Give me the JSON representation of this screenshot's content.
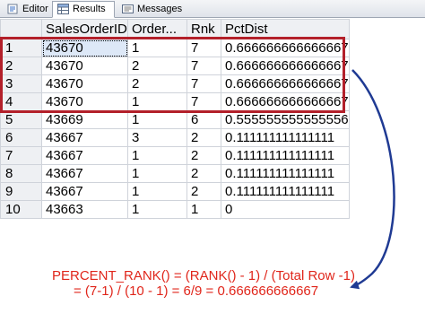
{
  "tabs": [
    {
      "label": "Editor",
      "icon": "editor-icon"
    },
    {
      "label": "Results",
      "icon": "results-grid-icon"
    },
    {
      "label": "Messages",
      "icon": "messages-icon"
    }
  ],
  "grid": {
    "columns": [
      "",
      "SalesOrderID",
      "Order...",
      "Rnk",
      "PctDist"
    ],
    "rows": [
      [
        "1",
        "43670",
        "1",
        "7",
        "0.666666666666667"
      ],
      [
        "2",
        "43670",
        "2",
        "7",
        "0.666666666666667"
      ],
      [
        "3",
        "43670",
        "2",
        "7",
        "0.666666666666667"
      ],
      [
        "4",
        "43670",
        "1",
        "7",
        "0.666666666666667"
      ],
      [
        "5",
        "43669",
        "1",
        "6",
        "0.555555555555556"
      ],
      [
        "6",
        "43667",
        "3",
        "2",
        "0.111111111111111"
      ],
      [
        "7",
        "43667",
        "1",
        "2",
        "0.111111111111111"
      ],
      [
        "8",
        "43667",
        "1",
        "2",
        "0.111111111111111"
      ],
      [
        "9",
        "43667",
        "1",
        "2",
        "0.111111111111111"
      ],
      [
        "10",
        "43663",
        "1",
        "1",
        "0"
      ]
    ]
  },
  "annotation": {
    "line1": "PERCENT_RANK() = (RANK() - 1) / (Total Row -1)",
    "line2": "= (7-1) / (10 - 1) = 6/9 = 0.666666666667",
    "highlight_color": "#b3202a",
    "arrow_color": "#1f3a93",
    "text_color": "#e0261b"
  }
}
